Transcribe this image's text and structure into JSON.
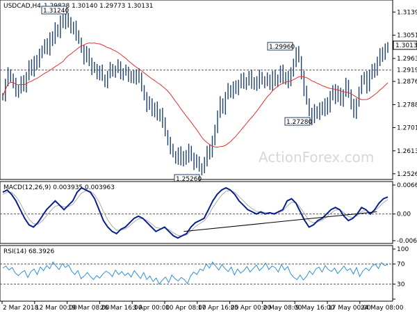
{
  "chart_data": [
    {
      "type": "ohlc",
      "symbol_header": "USDCAD,H4",
      "ohlc_header": "1.29828 1.30140 1.29773 1.30131",
      "watermark": "ActionForex.com",
      "ylim": [
        1.2515,
        1.3174
      ],
      "y_ticks": [
        "1.31390",
        "1.30510",
        "1.29630",
        "1.28760",
        "1.27880",
        "1.27010",
        "1.26130",
        "1.25260"
      ],
      "y_tick_values": [
        1.3139,
        1.3051,
        1.2963,
        1.2876,
        1.2788,
        1.2701,
        1.2613,
        1.2526
      ],
      "current_price": "1.30131",
      "current_value": 1.30131,
      "level_line": "1.29190",
      "level_value": 1.2919,
      "annotations": [
        {
          "text": "1.31240",
          "x": 57,
          "value": 1.3124
        },
        {
          "text": "1.25260",
          "x": 101,
          "value": 1.2526
        },
        {
          "text": "1.29960",
          "x": 164,
          "value": 1.2996
        },
        {
          "text": "1.27280",
          "x": 166,
          "value": 1.2728
        }
      ],
      "closes": [
        1.282,
        1.287,
        1.291,
        1.289,
        1.287,
        1.283,
        1.285,
        1.288,
        1.285,
        1.29,
        1.294,
        1.291,
        1.296,
        1.294,
        1.298,
        1.3,
        1.302,
        1.299,
        1.305,
        1.303,
        1.308,
        1.306,
        1.311,
        1.309,
        1.312,
        1.31,
        1.307,
        1.309,
        1.305,
        1.303,
        1.3,
        1.296,
        1.299,
        1.295,
        1.292,
        1.293,
        1.29,
        1.292,
        1.289,
        1.287,
        1.29,
        1.293,
        1.291,
        1.292,
        1.294,
        1.29,
        1.291,
        1.292,
        1.289,
        1.29,
        1.288,
        1.291,
        1.289,
        1.285,
        1.282,
        1.278,
        1.28,
        1.276,
        1.278,
        1.274,
        1.276,
        1.272,
        1.268,
        1.265,
        1.262,
        1.26,
        1.258,
        1.261,
        1.257,
        1.26,
        1.258,
        1.262,
        1.259,
        1.256,
        1.258,
        1.255,
        1.254,
        1.257,
        1.262,
        1.26,
        1.265,
        1.27,
        1.275,
        1.28,
        1.277,
        1.282,
        1.285,
        1.283,
        1.286,
        1.284,
        1.287,
        1.289,
        1.286,
        1.288,
        1.29,
        1.286,
        1.288,
        1.286,
        1.29,
        1.288,
        1.287,
        1.289,
        1.286,
        1.29,
        1.287,
        1.289,
        1.292,
        1.288,
        1.29,
        1.287,
        1.291,
        1.295,
        1.299,
        1.296,
        1.29,
        1.284,
        1.28,
        1.276,
        1.273,
        1.277,
        1.275,
        1.278,
        1.276,
        1.28,
        1.277,
        1.282,
        1.285,
        1.281,
        1.284,
        1.28,
        1.283,
        1.287,
        1.283,
        1.279,
        1.275,
        1.28,
        1.284,
        1.288,
        1.29,
        1.285,
        1.29,
        1.293,
        1.291,
        1.295,
        1.299,
        1.297,
        1.3,
        1.3013
      ],
      "ma_period": 50
    },
    {
      "type": "line",
      "title": "MACD(12,26,9) 0.003935 0.003963",
      "ylim": [
        -0.00611,
        0.00664
      ],
      "y_ticks": [
        "0.006639",
        "0.00",
        "-0.00611"
      ],
      "y_tick_values": [
        0.006639,
        0.0,
        -0.00611
      ],
      "zero_line": 0.0,
      "macd": [
        0.005,
        0.0055,
        0.0045,
        0.003,
        0.001,
        -0.001,
        -0.0025,
        -0.003,
        -0.002,
        -0.0005,
        0.001,
        0.002,
        0.003,
        0.002,
        0.001,
        0.002,
        0.003,
        0.005,
        0.006,
        0.0055,
        0.005,
        0.0035,
        0.001,
        -0.0015,
        -0.003,
        -0.004,
        -0.0045,
        -0.0035,
        -0.003,
        -0.002,
        -0.001,
        -0.0005,
        -0.001,
        -0.002,
        -0.003,
        -0.004,
        -0.0035,
        -0.003,
        -0.004,
        -0.005,
        -0.0055,
        -0.005,
        -0.0045,
        -0.003,
        -0.002,
        -0.0015,
        -0.001,
        0.001,
        0.003,
        0.0045,
        0.0055,
        0.006,
        0.0055,
        0.0045,
        0.003,
        0.002,
        0.001,
        0.0005,
        0.0,
        0.0005,
        0.0,
        0.0003,
        0.0,
        0.0005,
        0.001,
        0.003,
        0.0035,
        0.0025,
        0.0005,
        -0.0015,
        -0.003,
        -0.0025,
        -0.0015,
        -0.001,
        0.0,
        0.001,
        0.0015,
        0.001,
        -0.0005,
        -0.0015,
        -0.001,
        0.0,
        0.0015,
        0.001,
        0.0,
        0.001,
        0.0025,
        0.0035,
        0.0039
      ],
      "signal": [
        0.0045,
        0.005,
        0.005,
        0.004,
        0.0025,
        0.0005,
        -0.0012,
        -0.0022,
        -0.0024,
        -0.0016,
        -0.0004,
        0.0008,
        0.0018,
        0.002,
        0.0016,
        0.0017,
        0.0022,
        0.0035,
        0.0048,
        0.0053,
        0.0052,
        0.0044,
        0.0028,
        0.0006,
        -0.0014,
        -0.0028,
        -0.0037,
        -0.0037,
        -0.0034,
        -0.0027,
        -0.0018,
        -0.0011,
        -0.0011,
        -0.0015,
        -0.0022,
        -0.0031,
        -0.0033,
        -0.0032,
        -0.0036,
        -0.0043,
        -0.0049,
        -0.005,
        -0.0048,
        -0.0039,
        -0.0029,
        -0.0022,
        -0.0016,
        -0.0003,
        0.0015,
        0.003,
        0.0043,
        0.0052,
        0.0054,
        0.005,
        0.004,
        0.003,
        0.002,
        0.0012,
        0.0006,
        0.0005,
        0.0003,
        0.0003,
        0.0002,
        0.0003,
        0.0007,
        0.0018,
        0.0027,
        0.0026,
        0.0015,
        0.0,
        -0.0015,
        -0.002,
        -0.0018,
        -0.0014,
        -0.0007,
        0.0002,
        0.0009,
        0.001,
        0.0003,
        -0.0006,
        -0.0008,
        -0.0004,
        0.0006,
        0.0008,
        0.0004,
        0.0007,
        0.0016,
        0.0026,
        0.0033
      ],
      "trendline": [
        [
          0.47,
          -0.004
        ],
        [
          0.95,
          0.0005
        ]
      ]
    },
    {
      "type": "line",
      "title": "RSI(14) 68.3926",
      "ylim": [
        0,
        100
      ],
      "y_ticks": [
        "100",
        "70",
        "30",
        "0"
      ],
      "y_tick_values": [
        100,
        70,
        30,
        0
      ],
      "levels": [
        70,
        30
      ],
      "rsi": [
        62,
        66,
        58,
        63,
        52,
        47,
        53,
        57,
        43,
        55,
        60,
        49,
        64,
        57,
        67,
        61,
        74,
        66,
        59,
        71,
        63,
        68,
        56,
        49,
        57,
        41,
        46,
        53,
        45,
        39,
        47,
        42,
        50,
        56,
        52,
        45,
        58,
        49,
        55,
        47,
        52,
        44,
        57,
        49,
        41,
        53,
        39,
        46,
        35,
        42,
        30,
        38,
        44,
        33,
        48,
        41,
        36,
        43,
        39,
        31,
        46,
        54,
        49,
        60,
        57,
        70,
        62,
        74,
        66,
        58,
        69,
        61,
        55,
        64,
        48,
        60,
        52,
        57,
        65,
        54,
        61,
        68,
        57,
        63,
        72,
        59,
        66,
        63,
        54,
        69,
        58,
        65,
        50,
        43,
        39,
        48,
        38,
        45,
        56,
        49,
        60,
        64,
        54,
        67,
        59,
        55,
        62,
        51,
        58,
        66,
        57,
        61,
        50,
        63,
        45,
        56,
        62,
        57,
        66,
        70,
        61,
        73,
        67,
        69
      ],
      "x_ticks": [
        "2 Mar 2018",
        "12 Mar 00:00",
        "19 Mar 08:00",
        "26 Mar 16:00",
        "3 Apr 00:00",
        "10 Apr 08:00",
        "17 Apr 16:00",
        "25 Apr 00:00",
        "2 May 08:00",
        "9 May 16:00",
        "17 May 00:00",
        "24 May 08:00"
      ]
    }
  ]
}
